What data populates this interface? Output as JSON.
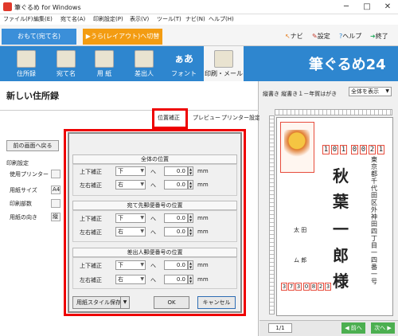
{
  "window": {
    "title": "筆ぐるめ for Windows",
    "minimize": "─",
    "maximize": "□",
    "close": "✕"
  },
  "menu": [
    "ファイル(F)",
    "編集(E)",
    "宛て名(A)",
    "印刷設定(P)",
    "表示(V)",
    "ツール(T)",
    "ナビ(N)",
    "ヘルプ(H)"
  ],
  "mode_tabs": {
    "front": "おもて(宛て名)",
    "back": "▶うら(レイアウト)へ切替"
  },
  "top_links": {
    "navi": "ナビ",
    "settings": "設定",
    "help": "ヘルプ",
    "exit": "終了"
  },
  "toolbar": [
    {
      "label": "住所録",
      "icon": "address-book-icon"
    },
    {
      "label": "宛て名",
      "icon": "addressee-icon"
    },
    {
      "label": "用 紙",
      "icon": "paper-icon"
    },
    {
      "label": "差出人",
      "icon": "sender-icon"
    },
    {
      "label": "フォント",
      "icon": "font-icon",
      "glyph": "ぁあ"
    },
    {
      "label": "印刷・メール",
      "icon": "printer-icon"
    }
  ],
  "brand": "筆ぐるめ24",
  "left": {
    "title": "新しい住所録",
    "subtabs": [
      "位置補正",
      "プレビュー",
      "プリンター設定"
    ],
    "back_button": "前の画面へ戻る",
    "print_settings": {
      "heading": "印刷設定",
      "rows": [
        {
          "label": "使用プリンター",
          "value": ""
        },
        {
          "label": "用紙サイズ",
          "value": "A4"
        },
        {
          "label": "印刷部数",
          "value": ""
        },
        {
          "label": "用紙の向き",
          "value": "縦"
        }
      ]
    }
  },
  "dialog": {
    "groups": [
      {
        "title": "全体の位置",
        "rows": [
          {
            "label": "上下補正",
            "dir": "下",
            "value": "0.0"
          },
          {
            "label": "左右補正",
            "dir": "右",
            "value": "0.0"
          }
        ]
      },
      {
        "title": "宛て先郵便番号の位置",
        "rows": [
          {
            "label": "上下補正",
            "dir": "下",
            "value": "0.0"
          },
          {
            "label": "左右補正",
            "dir": "右",
            "value": "0.0"
          }
        ]
      },
      {
        "title": "差出人郵便番号の位置",
        "rows": [
          {
            "label": "上下補正",
            "dir": "下",
            "value": "0.0"
          },
          {
            "label": "左右補正",
            "dir": "右",
            "value": "0.0"
          }
        ]
      }
    ],
    "he": "へ",
    "unit": "mm",
    "save_button": "用紙スタイル保存",
    "ok_button": "OK",
    "cancel_button": "キャンセル"
  },
  "preview": {
    "orientation_label": "縦書き 縦書き１－年賀はがき",
    "view_select": "全体を表示",
    "zip": [
      "1",
      "0",
      "1",
      "0",
      "0",
      "2",
      "1"
    ],
    "recipient_name": [
      "秋",
      "葉",
      "一",
      "郎",
      "様"
    ],
    "address": "東京都千代田区外神田四丁目一四番一号",
    "sender_name": [
      "太 田",
      "ム 郎"
    ],
    "sender_zip": [
      "3",
      "7",
      "3",
      "0",
      "8",
      "2",
      "3"
    ],
    "page": "1/1",
    "prev": "◀ 前へ",
    "next": "次へ ▶"
  }
}
